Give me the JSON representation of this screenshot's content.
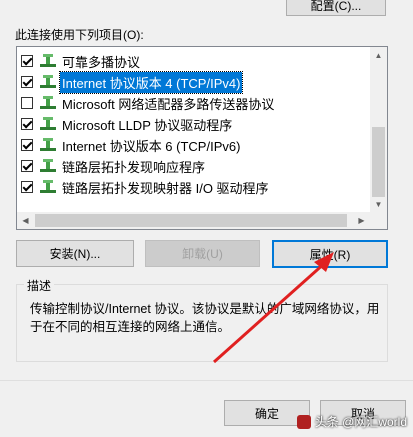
{
  "config_button": "配置(C)...",
  "list_label": "此连接使用下列项目(O):",
  "items": [
    {
      "label": "可靠多播协议",
      "checked": true,
      "selected": false
    },
    {
      "label": "Internet 协议版本 4 (TCP/IPv4)",
      "checked": true,
      "selected": true
    },
    {
      "label": "Microsoft 网络适配器多路传送器协议",
      "checked": false,
      "selected": false
    },
    {
      "label": "Microsoft LLDP 协议驱动程序",
      "checked": true,
      "selected": false
    },
    {
      "label": "Internet 协议版本 6 (TCP/IPv6)",
      "checked": true,
      "selected": false
    },
    {
      "label": "链路层拓扑发现响应程序",
      "checked": true,
      "selected": false
    },
    {
      "label": "链路层拓扑发现映射器 I/O 驱动程序",
      "checked": true,
      "selected": false
    }
  ],
  "buttons": {
    "install": "安装(N)...",
    "uninstall": "卸载(U)",
    "properties": "属性(R)",
    "ok": "确定",
    "cancel": "取消"
  },
  "description": {
    "title": "描述",
    "line1": "传输控制协议/Internet 协议。该协议是默认的广域网络协议，用",
    "line2": "于在不同的相互连接的网络上通信。"
  },
  "watermark": "头条 @网汇world",
  "colors": {
    "selection": "#0078d7",
    "annotation_arrow": "#e02020"
  }
}
